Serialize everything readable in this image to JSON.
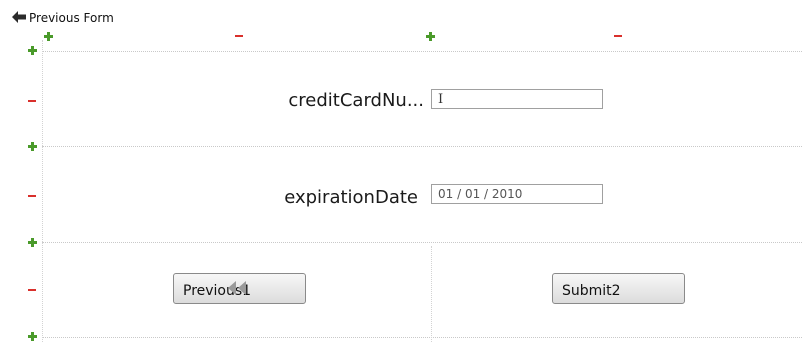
{
  "nav": {
    "previous_form_label": "Previous Form"
  },
  "form": {
    "fields": [
      {
        "label": "creditCardNu...",
        "value": "",
        "placeholder": ""
      },
      {
        "label": "expirationDate",
        "value": "01 / 01 / 2010"
      }
    ],
    "buttons": {
      "previous_label": "Previous1",
      "submit_label": "Submit2"
    }
  },
  "colors": {
    "plus": "#4a9a2a",
    "minus": "#d9302c",
    "grid": "#c9c9c9"
  },
  "icons": {
    "back": "arrow-left-icon",
    "add": "plus-icon",
    "remove": "minus-icon"
  }
}
